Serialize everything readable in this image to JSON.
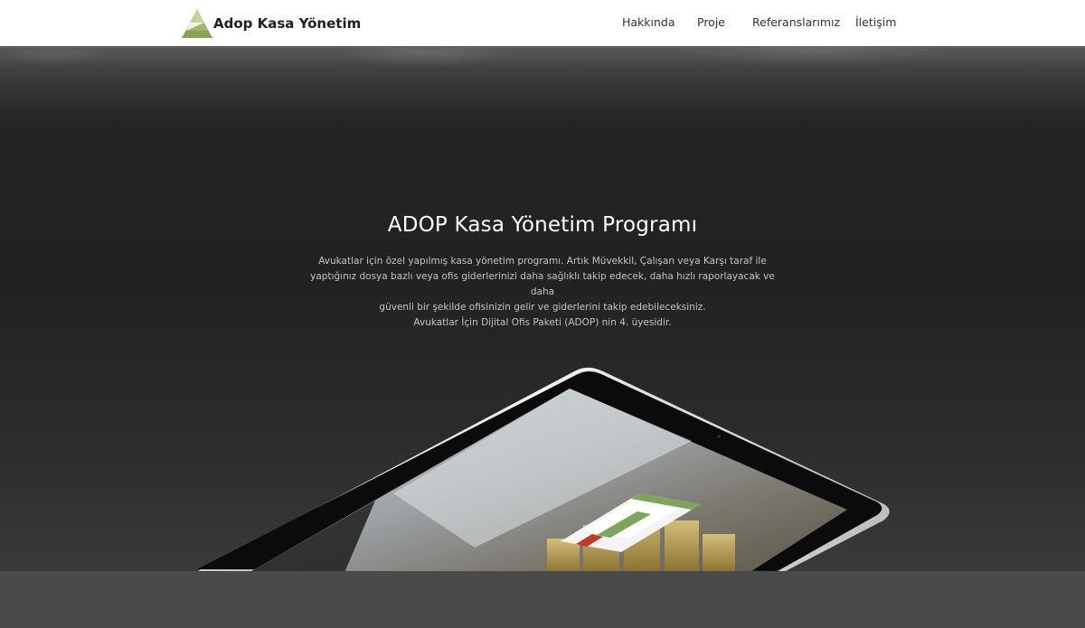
{
  "brand": {
    "name": "Adop Kasa Yönetim",
    "logo_icon": "triangle-logo-icon",
    "logo_colors": [
      "#a3b56b",
      "#8aa155",
      "#c8d39a"
    ]
  },
  "nav": {
    "items": [
      {
        "label": "Hakkında"
      },
      {
        "label": "Proje"
      },
      {
        "label": "Referanslarımız"
      },
      {
        "label": "İletişim"
      }
    ]
  },
  "hero": {
    "title": "ADOP Kasa Yönetim Programı",
    "description_lines": [
      "Avukatlar için özel yapılmış kasa yönetim programı. Artık Müvekkil, Çalışan veya Karşı taraf ile",
      "yaptığınız dosya bazlı veya ofis giderlerinizi daha sağlıklı takip edecek, daha hızlı raporlayacak ve daha",
      "güvenli bir şekilde ofisinizin gelir ve giderlerini takip edebileceksiniz.",
      "Avukatlar İçin Dijital Ofis Paketi (ADOP) nin 4. üyesidir."
    ],
    "image": "tablet-login-screenshot",
    "accent_color": "#7ea35a"
  },
  "colors": {
    "background": "#2c2c2c",
    "navbar": "#ffffff",
    "footer_band": "#4a4a4a"
  }
}
